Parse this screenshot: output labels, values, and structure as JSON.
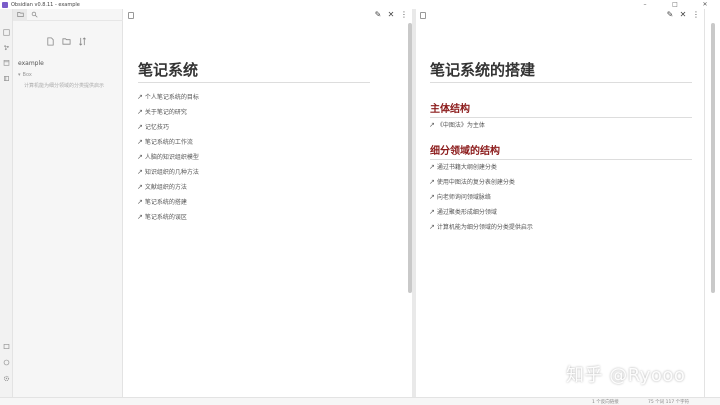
{
  "window": {
    "title": "Obsidian v0.8.11 - example",
    "controls": [
      "–",
      "□",
      "✕"
    ]
  },
  "sidebar": {
    "vault": "example",
    "folder": "Box",
    "file": "计算机能为细分领域的分类提供启示"
  },
  "left_pane": {
    "title": "笔记系统",
    "links": [
      "个人笔记系统的目标",
      "关于笔记的研究",
      "记忆技巧",
      "笔记系统的工作流",
      "人脑的知识组织模型",
      "知识组织的几种方法",
      "文献组织的方法",
      "笔记系统的搭建",
      "笔记系统的误区"
    ]
  },
  "right_pane": {
    "title": "笔记系统的搭建",
    "sections": [
      {
        "heading": "主体结构",
        "links": [
          "《中图法》为主体"
        ]
      },
      {
        "heading": "细分领域的结构",
        "links": [
          "通过书籍大纲创建分类",
          "使用中图法的复分表创建分类",
          "向老师询问领域脉络",
          "通过聚类形成细分领域",
          "计算机能为细分领域的分类提供启示"
        ]
      }
    ]
  },
  "pane_actions": {
    "edit": "✎",
    "close": "✕",
    "more": "⋮"
  },
  "statusbar": {
    "backlinks": "1 个反向链接",
    "counts": "75 个词  117 个字符"
  },
  "watermark": "知乎 @Ryooo",
  "colors": {
    "heading_red": "#8b1a1a",
    "ribbon_bg": "#f2f2f2",
    "sidebar_bg": "#f6f6f6"
  }
}
